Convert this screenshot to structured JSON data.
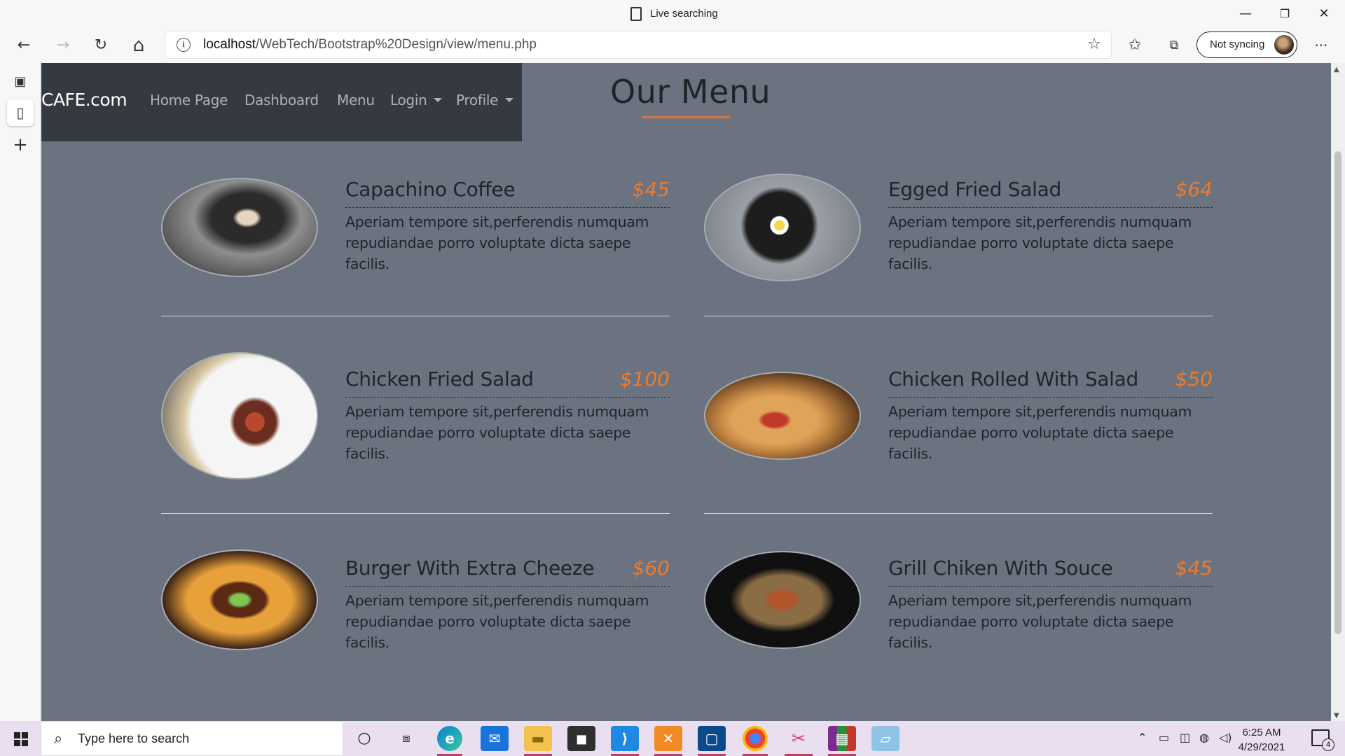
{
  "window": {
    "title": "Live searching",
    "minimize": "—",
    "restore": "❐",
    "close": "✕"
  },
  "toolbar": {
    "back": "←",
    "forward": "→",
    "refresh": "↻",
    "home": "⌂",
    "url_host": "localhost",
    "url_path": "/WebTech/Bootstrap%20Design/view/menu.php",
    "sync_label": "Not syncing",
    "more": "···"
  },
  "sidebar": {
    "items": [
      {
        "icon": "tab-actions-icon",
        "glyph": "▣"
      },
      {
        "icon": "page-icon",
        "glyph": "▯"
      },
      {
        "icon": "add-tab-icon",
        "glyph": "+"
      }
    ]
  },
  "site": {
    "brand": "CAFE.com",
    "nav": [
      "Home Page",
      "Dashboard",
      "Menu",
      "Login",
      "Profile"
    ],
    "heading": "Our Menu",
    "accent_color": "#f07a2c",
    "background_color": "#6b7380"
  },
  "menu": {
    "items": [
      {
        "name": "Capachino Coffee",
        "price": "$45",
        "desc": "Aperiam tempore sit,perferendis numquam repudiandae porro voluptate dicta saepe facilis.",
        "image": "coffee-cup-image"
      },
      {
        "name": "Egged Fried Salad",
        "price": "$64",
        "desc": "Aperiam tempore sit,perferendis numquam repudiandae porro voluptate dicta saepe facilis.",
        "image": "egg-breakfast-plate-image"
      },
      {
        "name": "Chicken Fried Salad",
        "price": "$100",
        "desc": "Aperiam tempore sit,perferendis numquam repudiandae porro voluptate dicta saepe facilis.",
        "image": "english-breakfast-image"
      },
      {
        "name": "Chicken Rolled With Salad",
        "price": "$50",
        "desc": "Aperiam tempore sit,perferendis numquam repudiandae porro voluptate dicta saepe facilis.",
        "image": "burrito-wrap-image"
      },
      {
        "name": "Burger With Extra Cheeze",
        "price": "$60",
        "desc": "Aperiam tempore sit,perferendis numquam repudiandae porro voluptate dicta saepe facilis.",
        "image": "cheese-burger-image"
      },
      {
        "name": "Grill Chiken With Souce",
        "price": "$45",
        "desc": "Aperiam tempore sit,perferendis numquam repudiandae porro voluptate dicta saepe facilis.",
        "image": "grilled-skewers-image"
      }
    ]
  },
  "taskbar": {
    "search_placeholder": "Type here to search",
    "time": "6:25 AM",
    "date": "4/29/2021",
    "notification_count": "4"
  }
}
